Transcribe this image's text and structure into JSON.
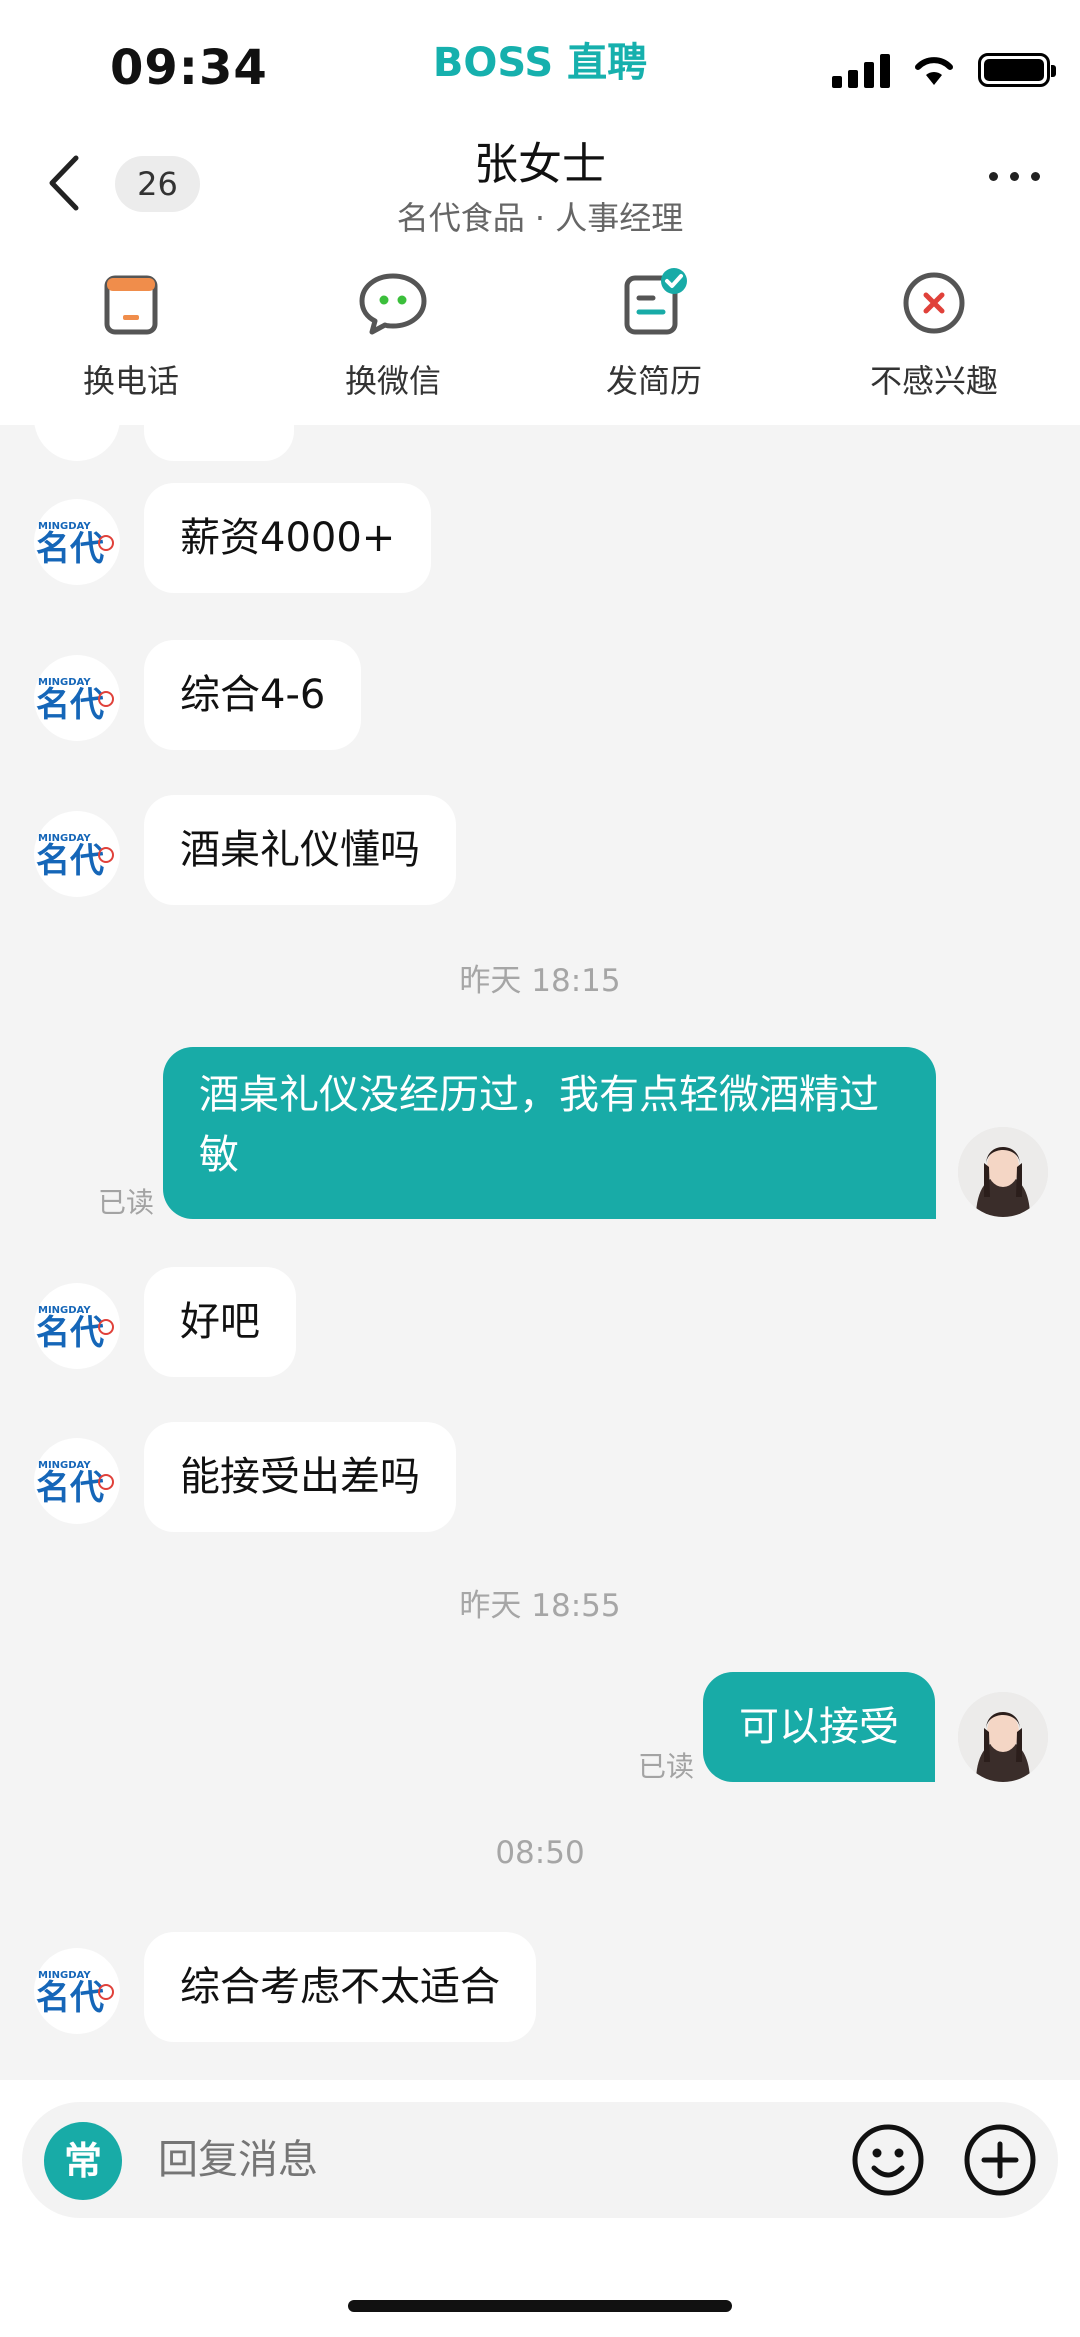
{
  "status_bar": {
    "time": "09:34",
    "brand": "BOSS 直聘"
  },
  "header": {
    "unread_count": "26",
    "contact_name": "张女士",
    "contact_subtitle": "名代食品 · 人事经理"
  },
  "actions": [
    {
      "label": "换电话",
      "icon": "phone-icon"
    },
    {
      "label": "换微信",
      "icon": "wechat-icon"
    },
    {
      "label": "发简历",
      "icon": "resume-icon"
    },
    {
      "label": "不感兴趣",
      "icon": "not-interested-icon"
    }
  ],
  "messages": {
    "m1": "薪资4000+",
    "m2": "综合4-6",
    "m3": "酒桌礼仪懂吗",
    "ts1": "昨天 18:15",
    "m4_line1": "酒桌礼仪没经历过，我有点轻微酒精过",
    "m4_line2": "敏",
    "read": "已读",
    "m5": "好吧",
    "m6": "能接受出差吗",
    "ts2": "昨天 18:55",
    "m7": "可以接受",
    "ts3": "08:50",
    "m8": "综合考虑不太适合"
  },
  "logo": {
    "mini": "MINGDAY",
    "big": "名代"
  },
  "input": {
    "quick_label": "常",
    "placeholder": "回复消息"
  },
  "colors": {
    "accent": "#18aba7",
    "brand": "#16b0ad",
    "reject": "#e0413a"
  }
}
